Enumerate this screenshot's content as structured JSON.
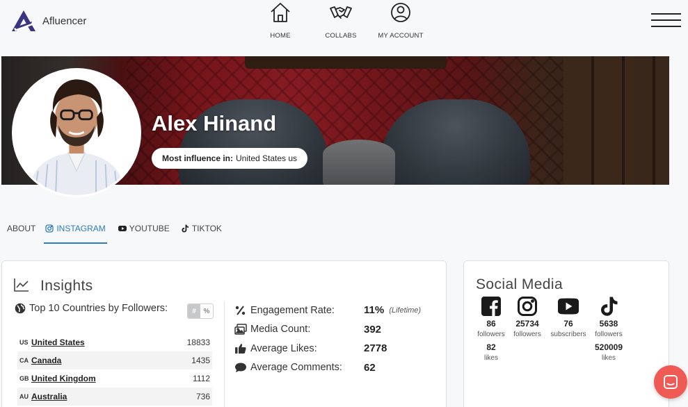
{
  "brand": {
    "name": "Afluencer",
    "accent": "#2a7bbf",
    "logo_color": "#3a3580"
  },
  "nav": {
    "items": [
      {
        "label": "HOME",
        "icon": "home-icon"
      },
      {
        "label": "COLLABS",
        "icon": "handshake-icon"
      },
      {
        "label": "MY ACCOUNT",
        "icon": "account-icon"
      }
    ],
    "menu_icon": "hamburger-icon"
  },
  "profile": {
    "name": "Alex Hinand",
    "influence_label": "Most influence in:",
    "influence_value": "United States us"
  },
  "tabs": [
    {
      "label": "ABOUT",
      "active": false
    },
    {
      "label": "INSTAGRAM",
      "active": true,
      "icon": "instagram-icon"
    },
    {
      "label": "YOUTUBE",
      "active": false,
      "icon": "youtube-icon"
    },
    {
      "label": "TIKTOK",
      "active": false,
      "icon": "tiktok-icon"
    }
  ],
  "insights": {
    "title": "Insights",
    "countries_title": "Top 10 Countries by Followers:",
    "toggle": {
      "count": "#",
      "percent": "%"
    },
    "countries": [
      {
        "code": "US",
        "name": "United States",
        "count": "18833"
      },
      {
        "code": "CA",
        "name": "Canada",
        "count": "1435"
      },
      {
        "code": "GB",
        "name": "United Kingdom",
        "count": "1112"
      },
      {
        "code": "AU",
        "name": "Australia",
        "count": "736"
      }
    ],
    "metrics": [
      {
        "label": "Engagement Rate:",
        "value": "11%",
        "note": "(Lifetime)",
        "icon": "percent-icon"
      },
      {
        "label": "Media Count:",
        "value": "392",
        "note": "",
        "icon": "images-icon"
      },
      {
        "label": "Average Likes:",
        "value": "2778",
        "note": "",
        "icon": "thumbs-up-icon"
      },
      {
        "label": "Average Comments:",
        "value": "62",
        "note": "",
        "icon": "comment-icon"
      }
    ]
  },
  "social": {
    "title": "Social Media",
    "platforms": [
      {
        "name": "facebook",
        "icon": "facebook-icon",
        "count": "86",
        "unit": "followers",
        "count2": "82",
        "unit2": "likes"
      },
      {
        "name": "instagram",
        "icon": "instagram-icon",
        "count": "25734",
        "unit": "followers",
        "count2": "",
        "unit2": ""
      },
      {
        "name": "youtube",
        "icon": "youtube-icon",
        "count": "76",
        "unit": "subscribers",
        "count2": "",
        "unit2": ""
      },
      {
        "name": "tiktok",
        "icon": "tiktok-icon",
        "count": "5638",
        "unit": "followers",
        "count2": "520009",
        "unit2": "likes"
      }
    ]
  },
  "chat": {
    "icon": "chat-icon",
    "color": "#ef5a55"
  }
}
